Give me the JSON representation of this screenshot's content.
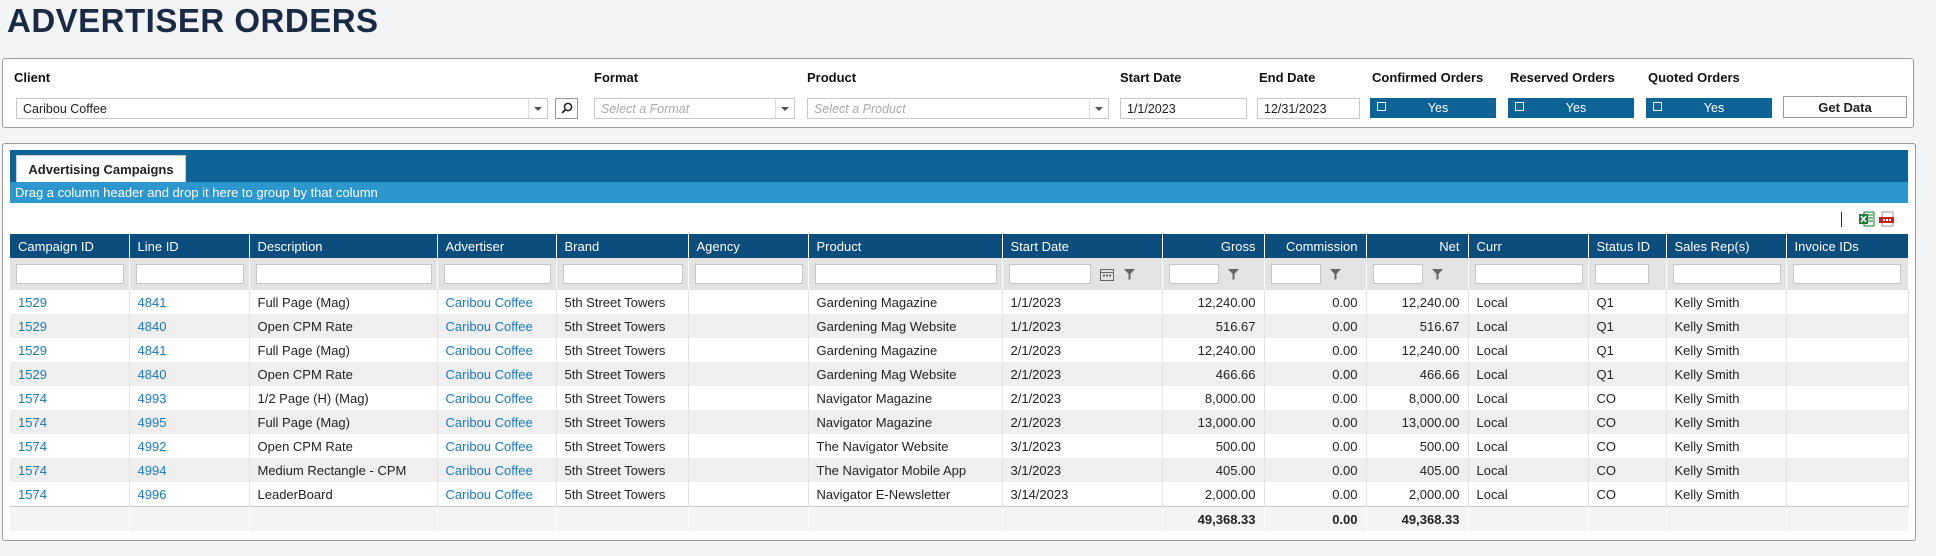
{
  "page_title": "ADVERTISER ORDERS",
  "filters": {
    "client": {
      "label": "Client",
      "value": "Caribou Coffee"
    },
    "format": {
      "label": "Format",
      "placeholder": "Select a Format"
    },
    "product": {
      "label": "Product",
      "placeholder": "Select a Product"
    },
    "start_date": {
      "label": "Start Date",
      "value": "1/1/2023"
    },
    "end_date": {
      "label": "End Date",
      "value": "12/31/2023"
    },
    "confirmed": {
      "label": "Confirmed Orders",
      "value": "Yes"
    },
    "reserved": {
      "label": "Reserved Orders",
      "value": "Yes"
    },
    "quoted": {
      "label": "Quoted Orders",
      "value": "Yes"
    },
    "get_data_label": "Get Data"
  },
  "tab_label": "Advertising Campaigns",
  "group_hint": "Drag a column header and drop it here to group by that column",
  "columns": [
    "Campaign ID",
    "Line ID",
    "Description",
    "Advertiser",
    "Brand",
    "Agency",
    "Product",
    "Start Date",
    "Gross",
    "Commission",
    "Net",
    "Curr",
    "Status ID",
    "Sales Rep(s)",
    "Invoice IDs"
  ],
  "rows": [
    [
      "1529",
      "4841",
      "Full Page (Mag)",
      "Caribou Coffee",
      "5th Street Towers",
      "",
      "Gardening Magazine",
      "1/1/2023",
      "12,240.00",
      "0.00",
      "12,240.00",
      "Local",
      "Q1",
      "Kelly Smith",
      ""
    ],
    [
      "1529",
      "4840",
      "Open CPM Rate",
      "Caribou Coffee",
      "5th Street Towers",
      "",
      "Gardening Mag Website",
      "1/1/2023",
      "516.67",
      "0.00",
      "516.67",
      "Local",
      "Q1",
      "Kelly Smith",
      ""
    ],
    [
      "1529",
      "4841",
      "Full Page (Mag)",
      "Caribou Coffee",
      "5th Street Towers",
      "",
      "Gardening Magazine",
      "2/1/2023",
      "12,240.00",
      "0.00",
      "12,240.00",
      "Local",
      "Q1",
      "Kelly Smith",
      ""
    ],
    [
      "1529",
      "4840",
      "Open CPM Rate",
      "Caribou Coffee",
      "5th Street Towers",
      "",
      "Gardening Mag Website",
      "2/1/2023",
      "466.66",
      "0.00",
      "466.66",
      "Local",
      "Q1",
      "Kelly Smith",
      ""
    ],
    [
      "1574",
      "4993",
      "1/2 Page (H) (Mag)",
      "Caribou Coffee",
      "5th Street Towers",
      "",
      "Navigator Magazine",
      "2/1/2023",
      "8,000.00",
      "0.00",
      "8,000.00",
      "Local",
      "CO",
      "Kelly Smith",
      ""
    ],
    [
      "1574",
      "4995",
      "Full Page (Mag)",
      "Caribou Coffee",
      "5th Street Towers",
      "",
      "Navigator Magazine",
      "2/1/2023",
      "13,000.00",
      "0.00",
      "13,000.00",
      "Local",
      "CO",
      "Kelly Smith",
      ""
    ],
    [
      "1574",
      "4992",
      "Open CPM Rate",
      "Caribou Coffee",
      "5th Street Towers",
      "",
      "The Navigator Website",
      "3/1/2023",
      "500.00",
      "0.00",
      "500.00",
      "Local",
      "CO",
      "Kelly Smith",
      ""
    ],
    [
      "1574",
      "4994",
      "Medium Rectangle - CPM",
      "Caribou Coffee",
      "5th Street Towers",
      "",
      "The Navigator Mobile App",
      "3/1/2023",
      "405.00",
      "0.00",
      "405.00",
      "Local",
      "CO",
      "Kelly Smith",
      ""
    ],
    [
      "1574",
      "4996",
      "LeaderBoard",
      "Caribou Coffee",
      "5th Street Towers",
      "",
      "Navigator E-Newsletter",
      "3/14/2023",
      "2,000.00",
      "0.00",
      "2,000.00",
      "Local",
      "CO",
      "Kelly Smith",
      ""
    ]
  ],
  "totals": {
    "gross": "49,368.33",
    "commission": "0.00",
    "net": "49,368.33"
  },
  "colors": {
    "header_blue": "#0b4d7d",
    "tab_blue": "#0e6396",
    "group_blue": "#2b97cc",
    "link_blue": "#1a7ab8"
  }
}
